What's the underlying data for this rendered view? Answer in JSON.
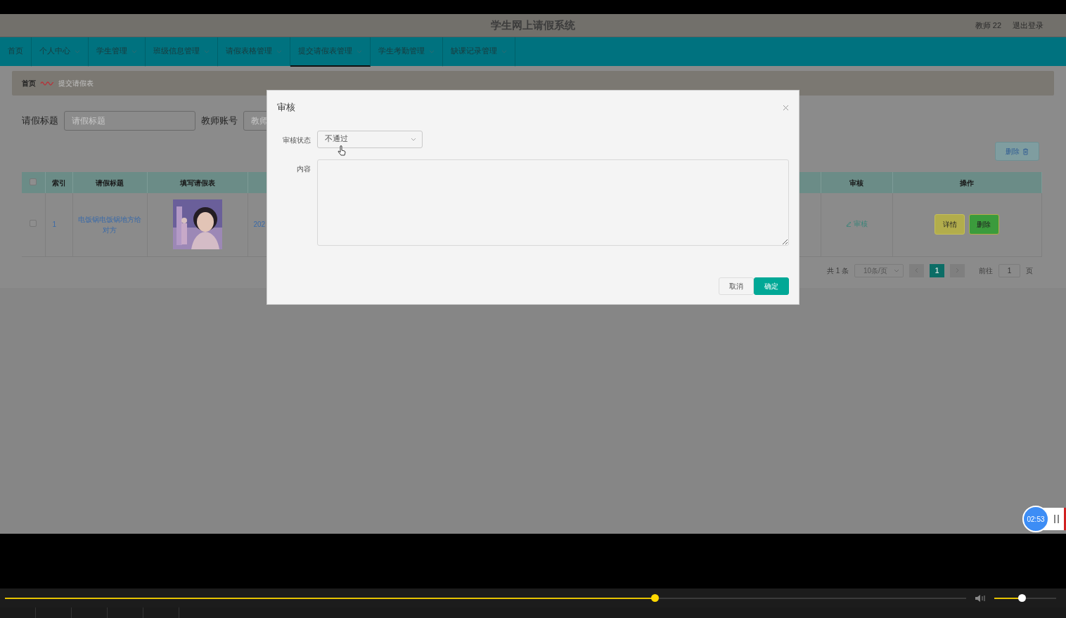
{
  "app": {
    "title": "学生网上请假系统",
    "user": "教师 22",
    "logout": "退出登录"
  },
  "nav": [
    {
      "label": "首页",
      "dropdown": false,
      "selected": false
    },
    {
      "label": "个人中心",
      "dropdown": true,
      "selected": false
    },
    {
      "label": "学生管理",
      "dropdown": true,
      "selected": false
    },
    {
      "label": "班级信息管理",
      "dropdown": true,
      "selected": false
    },
    {
      "label": "请假表格管理",
      "dropdown": true,
      "selected": false
    },
    {
      "label": "提交请假表管理",
      "dropdown": true,
      "selected": true
    },
    {
      "label": "学生考勤管理",
      "dropdown": true,
      "selected": false
    },
    {
      "label": "缺课记录管理",
      "dropdown": true,
      "selected": false
    }
  ],
  "breadcrumb": [
    "首页",
    "提交请假表"
  ],
  "search": [
    {
      "label": "请假标题",
      "placeholder": "请假标题"
    },
    {
      "label": "教师账号",
      "placeholder": "教师"
    }
  ],
  "delete_button": "删除",
  "table": {
    "header_checked": false,
    "columns": [
      "索引",
      "请假标题",
      "填写请假表",
      "审核",
      "操作"
    ],
    "rows": [
      {
        "checked": false,
        "index": "1",
        "title": "电饭锅电饭锅地方给对方",
        "column_4": "202",
        "review": "审核",
        "actions": [
          {
            "label": "详情",
            "kind": "detail"
          },
          {
            "label": "删除",
            "kind": "delete"
          }
        ]
      }
    ]
  },
  "pagination": {
    "total": "共 1 条",
    "page_size": "10条/页",
    "pages": [
      {
        "label": "1",
        "selected": true
      }
    ],
    "goto_label": "前往",
    "goto_value": "1",
    "page_suffix": "页"
  },
  "dialog": {
    "title": "审核",
    "fields": [
      {
        "kind": "select",
        "label": "审核状态",
        "value": "不通过"
      },
      {
        "kind": "textarea",
        "label": "内容"
      }
    ],
    "buttons": [
      {
        "label": "取消",
        "kind": "secondary"
      },
      {
        "label": "确定",
        "kind": "primary"
      }
    ]
  },
  "player": {
    "progress": {
      "level": 0.676
    },
    "volume": {
      "level": 0.44
    }
  },
  "recorder": {
    "time": "02:53"
  }
}
